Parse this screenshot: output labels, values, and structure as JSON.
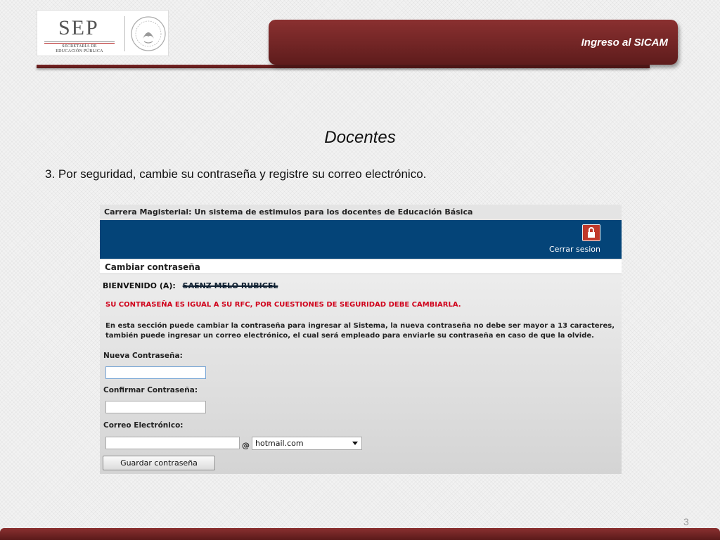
{
  "logo": {
    "name": "SEP",
    "subtitle_line1": "SECRETARÍA DE",
    "subtitle_line2": "EDUCACIÓN PÚBLICA"
  },
  "header": {
    "title": "Ingreso al SICAM"
  },
  "slide": {
    "title": "Docentes",
    "instruction": "3. Por seguridad, cambie su contraseña y registre su correo electrónico.",
    "page_number": "3"
  },
  "screen": {
    "app_title": "Carrera Magisterial: Un sistema de estimulos para los docentes de Educación Básica",
    "logout_label": "Cerrar sesion",
    "section_title": "Cambiar contraseña",
    "welcome_label": "BIENVENIDO (A):",
    "welcome_name": "SAENZ MELO RUBICEL",
    "warning": "SU CONTRASEÑA ES IGUAL A SU RFC, POR CUESTIONES DE SEGURIDAD DEBE CAMBIARLA.",
    "info": "En esta sección puede cambiar la contraseña para ingresar al Sistema, la nueva contraseña no debe ser mayor a 13 caracteres, también puede ingresar un correo electrónico, el cual será empleado para enviarle su contraseña en caso de que la olvide.",
    "fields": {
      "new_password_label": "Nueva Contraseña:",
      "new_password_value": "",
      "confirm_password_label": "Confirmar Contraseña:",
      "confirm_password_value": "",
      "email_label": "Correo Electrónico:",
      "email_value": "",
      "at_symbol": "@",
      "domain_selected": "hotmail.com"
    },
    "save_label": "Guardar contraseña"
  },
  "colors": {
    "brand_maroon": "#7a2626",
    "app_blue": "#044478",
    "warning_red": "#d0021b"
  },
  "icons": {
    "lock": "lock-icon",
    "seal": "national-seal-icon",
    "dropdown": "chevron-down-icon"
  }
}
